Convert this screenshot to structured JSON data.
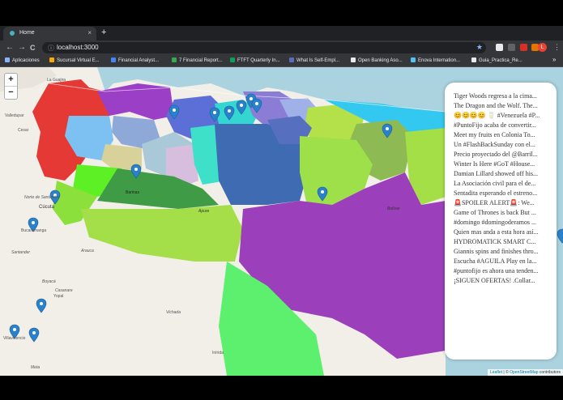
{
  "browser": {
    "tab_title": "Home",
    "url": "localhost:3000",
    "new_tab": "+",
    "close_glyph": "×",
    "back_glyph": "←",
    "forward_glyph": "→",
    "reload_glyph": "C",
    "lock_glyph": "ⓘ",
    "star_glyph": "★",
    "overflow_glyph": "⋮",
    "profile_initial": "L",
    "bookmarks_overflow": "»"
  },
  "bookmarks": [
    {
      "label": "Aplicaciones",
      "color": "#8ab4f8"
    },
    {
      "label": "Sucursal Virtual E...",
      "color": "#f9ab00"
    },
    {
      "label": "Financial Analyst...",
      "color": "#4285f4"
    },
    {
      "label": "7 Financial Report...",
      "color": "#34a853"
    },
    {
      "label": "FTFT Quarterly In...",
      "color": "#0f9d58"
    },
    {
      "label": "What Is Self-Empl...",
      "color": "#5c6bc0"
    },
    {
      "label": "Open Banking Aso...",
      "color": "#e8eaed"
    },
    {
      "label": "Enova Internation...",
      "color": "#4fc3f7"
    },
    {
      "label": "Guia_Practica_Re...",
      "color": "#e8eaed"
    }
  ],
  "map": {
    "zoom_in": "+",
    "zoom_out": "−",
    "attribution_leaflet": "Leaflet",
    "attribution_sep": " | © ",
    "attribution_osm": "OpenStreetMap",
    "attribution_tail": " contributors",
    "labels": [
      {
        "text": "La Guajira"
      },
      {
        "text": "Valledupar"
      },
      {
        "text": "Cesar"
      },
      {
        "text": "Cúcuta"
      },
      {
        "text": "Norte de Santander"
      },
      {
        "text": "Bucaramanga"
      },
      {
        "text": "Santander"
      },
      {
        "text": "Casanare"
      },
      {
        "text": "Yopal"
      },
      {
        "text": "Arauca"
      },
      {
        "text": "Boyacá"
      },
      {
        "text": "Meta"
      },
      {
        "text": "Vichada"
      },
      {
        "text": "Villavicencio"
      },
      {
        "text": "Inírida"
      },
      {
        "text": "Bolívar"
      },
      {
        "text": "Apure"
      },
      {
        "text": "Barinas"
      }
    ]
  },
  "tweets": [
    "Tiger Woods regresa a la cima...",
    "The Dragon and the Wolf. The...",
    "😊😊😊😊 🥛 #Venezuela #P...",
    "#PuntoFijo acaba de convertir...",
    "Meet my fruits en Colonia To...",
    "Un #FlashBackSunday con el...",
    "Precio proyectado del @Barril...",
    "Winter Is Here #GoT #House...",
    "Damian Lillard showed off his...",
    "La Asociación civil para el de...",
    "Sentadita esperando el estreno...",
    "🚨SPOILER ALERT🚨: We...",
    "Game of Thrones is back But ...",
    "#domingo #domingoderamos ...",
    "Quien mas anda a esta hora así...",
    "HYDROMATICK SMART C...",
    "Giannis spins and finishes thro...",
    "Escucha #AGUILA Play en la...",
    "#puntofijo es ahora una tenden...",
    "¡SIGUEN OFERTAS! .Collar..."
  ]
}
